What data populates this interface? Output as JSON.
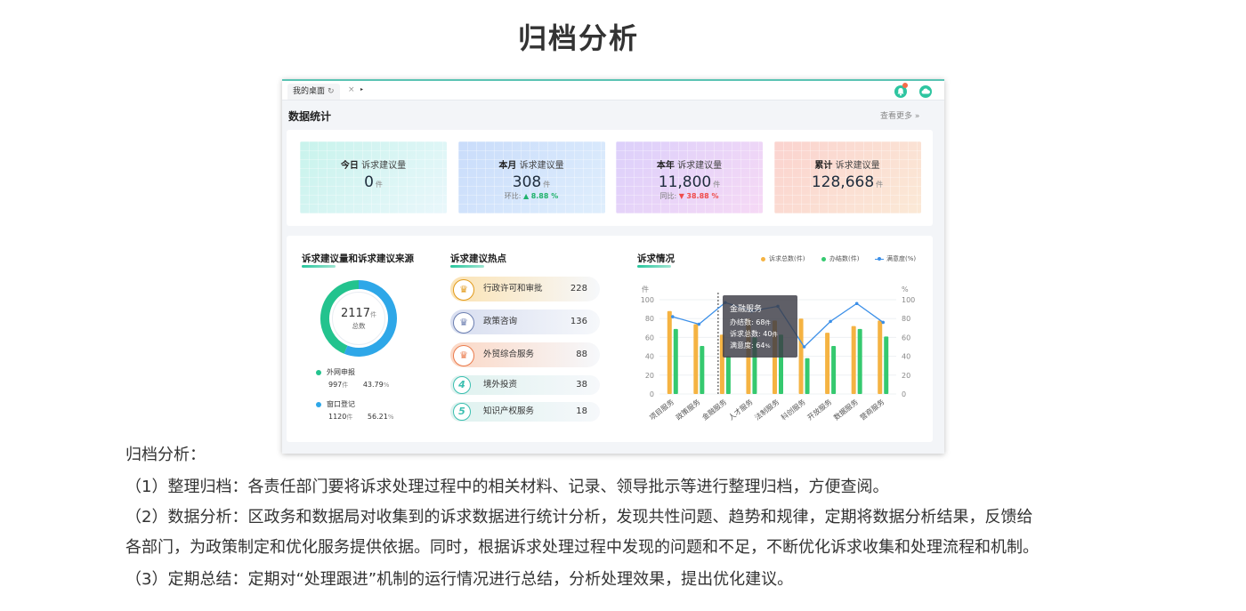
{
  "page_title": "归档分析",
  "dashboard": {
    "tab": {
      "label": "我的桌面",
      "refresh_glyph": "↻",
      "close_glyph": "×",
      "arrow_glyph": "▸"
    },
    "header_icons": [
      "bell-icon",
      "cloud-icon"
    ],
    "section_title": "数据统计",
    "more_link": "查看更多 »",
    "cards": [
      {
        "label_bold": "今日",
        "label": "诉求建议量",
        "value": "0",
        "unit": "件",
        "sub_label": "",
        "sub_value": "",
        "trend": "",
        "color_from": "#c8f3ec",
        "color_to": "#e9f7fb"
      },
      {
        "label_bold": "本月",
        "label": "诉求建议量",
        "value": "308",
        "unit": "件",
        "sub_label": "环比:",
        "sub_value": "8.88 %",
        "trend": "up",
        "color_from": "#c9dcfb",
        "color_to": "#dfeefc"
      },
      {
        "label_bold": "本年",
        "label": "诉求建议量",
        "value": "11,800",
        "unit": "件",
        "sub_label": "同比:",
        "sub_value": "38.88 %",
        "trend": "down",
        "color_from": "#dcd0fb",
        "color_to": "#f6d9f5"
      },
      {
        "label_bold": "累计",
        "label": "诉求建议量",
        "value": "128,668",
        "unit": "件",
        "sub_label": "",
        "sub_value": "",
        "trend": "",
        "color_from": "#fbd3cf",
        "color_to": "#fbe9d6"
      }
    ],
    "source": {
      "title": "诉求建议量和诉求建议来源",
      "total": "2117",
      "total_unit": "件",
      "total_label": "总数",
      "items": [
        {
          "name": "外网申报",
          "count": "997",
          "unit": "件",
          "percent": "43.79",
          "percent_unit": "%",
          "color": "#23c38e",
          "share": 0.4379
        },
        {
          "name": "窗口登记",
          "count": "1120",
          "unit": "件",
          "percent": "56.21",
          "percent_unit": "%",
          "color": "#2ea7e8",
          "share": 0.5621
        }
      ]
    },
    "hot": {
      "title": "诉求建议热点",
      "items": [
        {
          "rank_glyph": "♛",
          "name": "行政许可和审批",
          "count": "228",
          "bg": "#fbe3b4",
          "fg": "#e29a1a"
        },
        {
          "rank_glyph": "♛",
          "name": "政策咨询",
          "count": "136",
          "bg": "#d8def0",
          "fg": "#6b7eb0"
        },
        {
          "rank_glyph": "♛",
          "name": "外贸综合服务",
          "count": "88",
          "bg": "#fbd8c6",
          "fg": "#ea7b4c"
        },
        {
          "rank_glyph": "4",
          "name": "境外投资",
          "count": "38",
          "bg": "#dff2ef",
          "fg": "#3bbfb0"
        },
        {
          "rank_glyph": "5",
          "name": "知识产权服务",
          "count": "18",
          "bg": "#dff2ef",
          "fg": "#3bbfb0"
        }
      ]
    },
    "chart_data": {
      "type": "bar",
      "title": "诉求情况",
      "categories": [
        "项目服务",
        "政策服务",
        "金融服务",
        "人才服务",
        "法制服务",
        "科创服务",
        "开放服务",
        "数据服务",
        "营商服务"
      ],
      "y_left_label": "件",
      "y_right_label": "%",
      "ylim": [
        0,
        100
      ],
      "yticks": [
        0,
        20,
        40,
        60,
        80,
        100
      ],
      "series": [
        {
          "name": "诉求总数(件)",
          "type": "bar",
          "color": "#f5b342",
          "values": [
            88,
            74,
            63,
            80,
            78,
            80,
            65,
            72,
            78
          ]
        },
        {
          "name": "办结数(件)",
          "type": "bar",
          "color": "#35c96f",
          "values": [
            69,
            51,
            40,
            60,
            63,
            38,
            51,
            69,
            61
          ]
        },
        {
          "name": "满意度(%)",
          "type": "line",
          "color": "#3b8fe8",
          "values": [
            82,
            74,
            97,
            88,
            93,
            50,
            77,
            96,
            76
          ]
        }
      ],
      "legend_position": "top-right",
      "tooltip": {
        "title": "金融服务",
        "rows": [
          {
            "label": "办结数:",
            "value": "68",
            "unit": "件"
          },
          {
            "label": "诉求总数:",
            "value": "40",
            "unit": "件"
          },
          {
            "label": "满意度:",
            "value": "64",
            "unit": "%"
          }
        ]
      }
    }
  },
  "description": {
    "heading": "归档分析：",
    "lines": [
      "（1）整理归档：各责任部门要将诉求处理过程中的相关材料、记录、领导批示等进行整理归档，方便查阅。",
      "（2）数据分析：区政务和数据局对收集到的诉求数据进行统计分析，发现共性问题、趋势和规律，定期将数据分析结果，反馈给",
      "各部门，为政策制定和优化服务提供依据。同时，根据诉求处理过程中发现的问题和不足，不断优化诉求收集和处理流程和机制。",
      "（3）定期总结：定期对“处理跟进”机制的运行情况进行总结，分析处理效果，提出优化建议。"
    ]
  }
}
